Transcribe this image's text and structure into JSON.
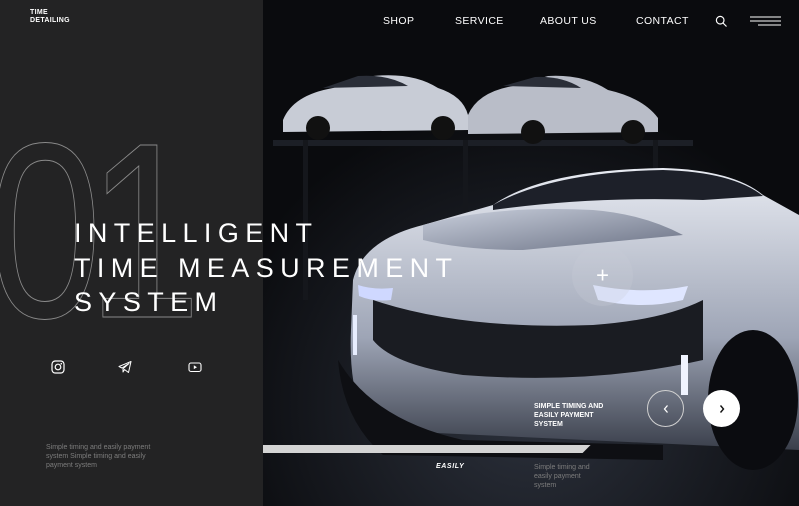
{
  "brand": {
    "line1": "TIME",
    "line2": "DETAILING"
  },
  "nav": {
    "items": [
      "SHOP",
      "SERVICE",
      "ABOUT US",
      "CONTACT"
    ]
  },
  "header_icons": {
    "search": "search-icon",
    "menu": "menu-icon"
  },
  "hero": {
    "slide_number": "01",
    "headline": [
      "INTELLIGENT",
      "TIME MEASUREMENT",
      "SYSTEM"
    ],
    "caption": "SIMPLE TIMING AND EASILY PAYMENT SYSTEM",
    "tab_label": "EASILY",
    "plus_symbol": "+"
  },
  "social": {
    "icons": [
      "instagram-icon",
      "telegram-icon",
      "youtube-icon"
    ]
  },
  "footer": {
    "left_text": "Simple timing and easily payment system Simple timing and easily payment system",
    "right_text": "Simple timing and easily payment system"
  },
  "slider": {
    "progress": 0.9
  },
  "colors": {
    "panel": "#232324",
    "accent": "#ffffff",
    "muted": "#7d7d7d"
  }
}
